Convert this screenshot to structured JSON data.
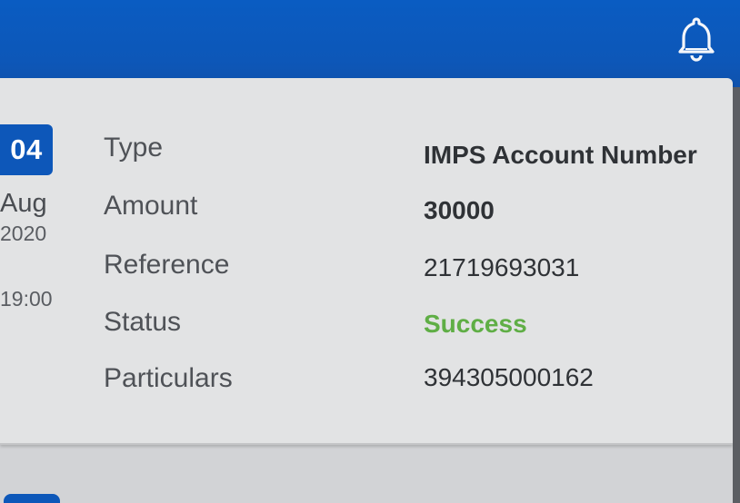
{
  "transaction": {
    "day": "04",
    "month": "Aug",
    "year": "2020",
    "time": "19:00",
    "fields": [
      {
        "label": "Type",
        "value": "IMPS Account Number"
      },
      {
        "label": "Amount",
        "value": "30000"
      },
      {
        "label": "Reference",
        "value": "21719693031"
      },
      {
        "label": "Status",
        "value": "Success"
      },
      {
        "label": "Particulars",
        "value": "394305000162"
      }
    ]
  },
  "header": {
    "bell_icon": "bell-icon"
  },
  "colors": {
    "primary": "#0d57b9",
    "success": "#5fae45"
  }
}
